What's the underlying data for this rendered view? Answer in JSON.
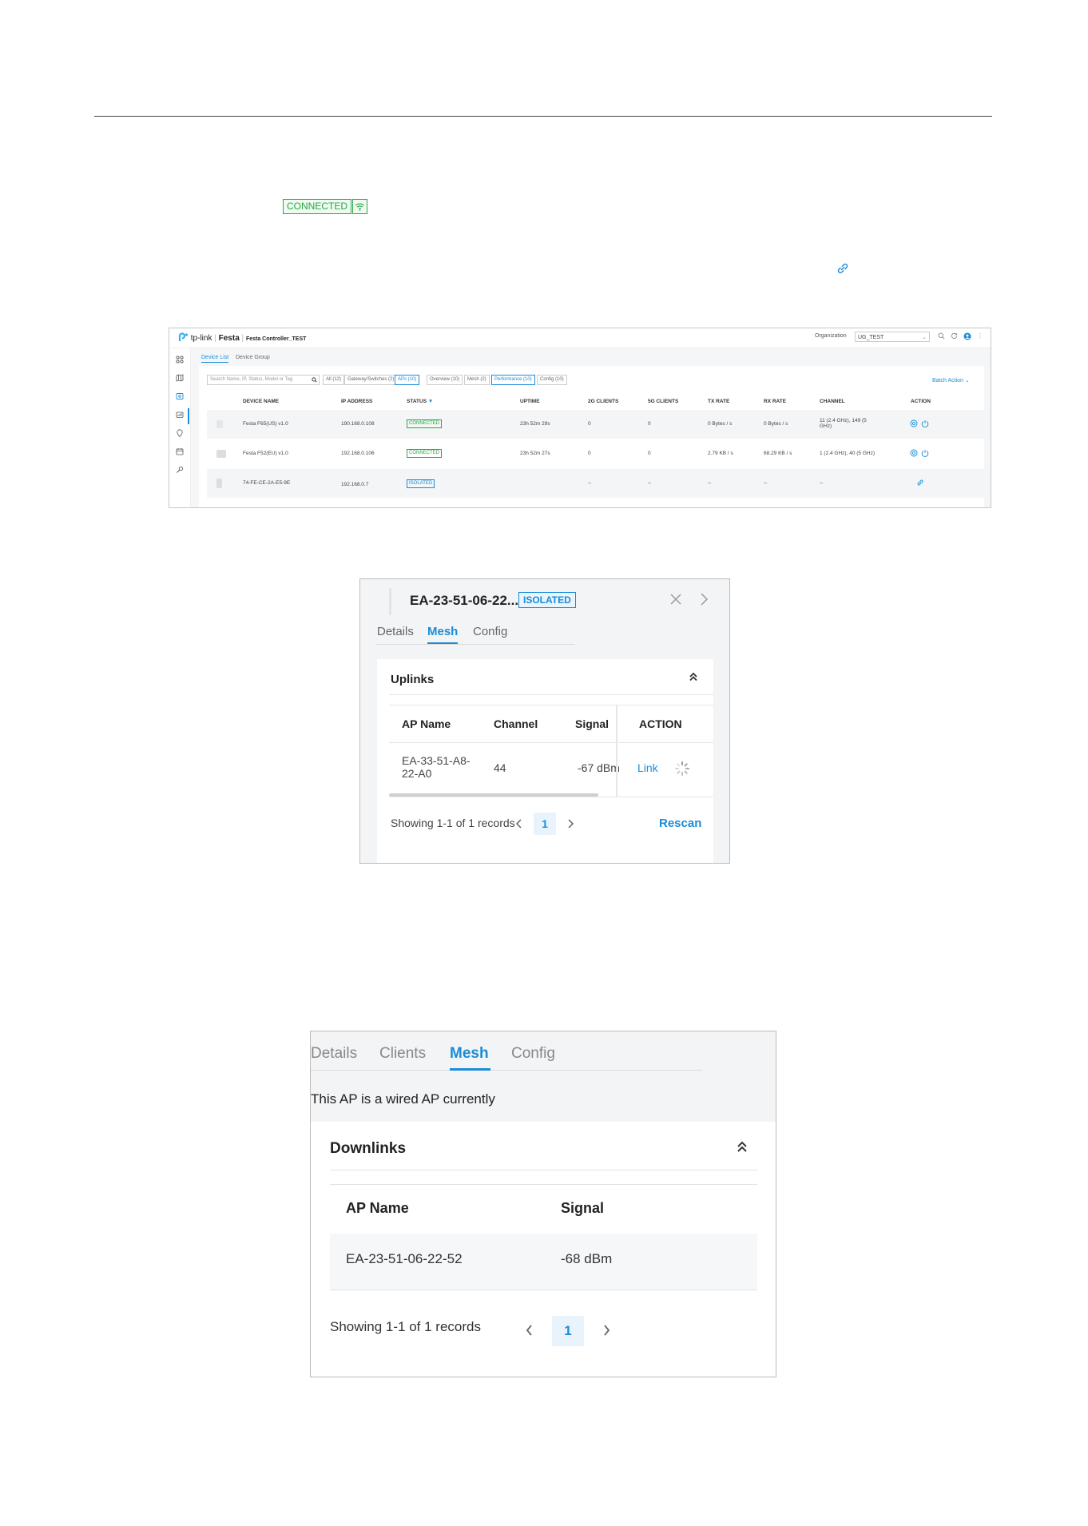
{
  "doc": {
    "connected_badge": "CONNECTED"
  },
  "controller": {
    "brand": "tp-link",
    "product": "Festa",
    "controller_name": "Festa Controller_TEST",
    "org_label": "Organization",
    "org_value": "UG_TEST",
    "subtabs": [
      "Device List",
      "Device Group"
    ],
    "search_placeholder": "Search Name, IP, Status, Model or Tag",
    "filters_type": [
      "All (12)",
      "Gateway/Switches (2)",
      "APs (10)"
    ],
    "filters_view": [
      "Overview (10)",
      "Mesh (2)",
      "Performance (10)",
      "Config (10)"
    ],
    "batch_action": "Batch Action",
    "columns": [
      "DEVICE NAME",
      "IP ADDRESS",
      "STATUS",
      "UPTIME",
      "2G CLIENTS",
      "5G CLIENTS",
      "TX RATE",
      "RX RATE",
      "CHANNEL",
      "ACTION"
    ],
    "rows": [
      {
        "name": "Festa F65(US) v1.0",
        "ip": "190.168.0.108",
        "status": "CONNECTED",
        "uptime": "23h 52m 29s",
        "c2g": "0",
        "c5g": "0",
        "tx": "0 Bytes / s",
        "rx": "0 Bytes / s",
        "channel": "11 (2.4 GHz), 149 (5 GHz)"
      },
      {
        "name": "Festa F52(EU) v1.0",
        "ip": "192.168.0.106",
        "status": "CONNECTED",
        "uptime": "23h 52m 27s",
        "c2g": "0",
        "c5g": "0",
        "tx": "2.79 KB / s",
        "rx": "68.29 KB / s",
        "channel": "1 (2.4 GHz), 40 (5 GHz)"
      },
      {
        "name": "74-FE-CE-2A-E5-9E",
        "ip": "192.168.0.7",
        "status": "ISOLATED",
        "uptime": "",
        "c2g": "--",
        "c5g": "--",
        "tx": "--",
        "rx": "--",
        "channel": "--"
      }
    ]
  },
  "isolated_panel": {
    "title": "EA-23-51-06-22...",
    "badge": "ISOLATED",
    "tabs": [
      "Details",
      "Mesh",
      "Config"
    ],
    "section": "Uplinks",
    "columns": [
      "AP Name",
      "Channel",
      "Signal",
      "ACTION"
    ],
    "row": {
      "name_line1": "EA-33-51-A8-",
      "name_line2": "22-A0",
      "channel": "44",
      "signal": "-67 dBm",
      "action": "Link"
    },
    "showing": "Showing 1-1 of 1 records",
    "page": "1",
    "rescan": "Rescan"
  },
  "wired_panel": {
    "tabs": [
      "Details",
      "Clients",
      "Mesh",
      "Config"
    ],
    "message": "This AP is a wired AP currently",
    "section": "Downlinks",
    "columns": [
      "AP Name",
      "Signal"
    ],
    "row": {
      "name": "EA-23-51-06-22-52",
      "signal": "-68 dBm"
    },
    "showing": "Showing 1-1 of 1 records",
    "page": "1"
  },
  "colors": {
    "accent": "#1a8cd8",
    "connected": "#27a844",
    "brand_logo": "#2fb2e8"
  }
}
